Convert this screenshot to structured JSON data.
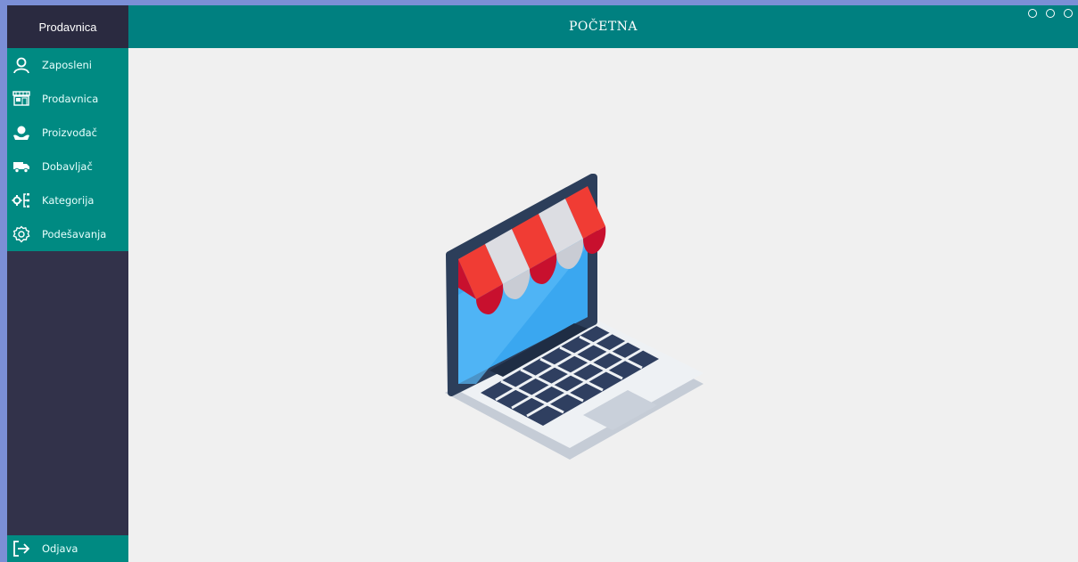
{
  "app": {
    "brand": "Prodavnica",
    "page_title": "POČETNA"
  },
  "sidebar": {
    "items": [
      {
        "label": "Zaposleni",
        "icon": "user-icon"
      },
      {
        "label": "Prodavnica",
        "icon": "store-icon"
      },
      {
        "label": "Proizvođač",
        "icon": "manufacturer-icon"
      },
      {
        "label": "Dobavljač",
        "icon": "truck-icon"
      },
      {
        "label": "Kategorija",
        "icon": "category-icon"
      },
      {
        "label": "Podešavanja",
        "icon": "gear-icon"
      }
    ],
    "logout_label": "Odjava"
  },
  "window_controls": [
    "minimize",
    "maximize",
    "close"
  ],
  "colors": {
    "accent": "#008080",
    "menu": "#008a82",
    "sidebar_dark": "#32324a",
    "background": "#f0f0f0",
    "desktop": "#7b8fd6"
  }
}
